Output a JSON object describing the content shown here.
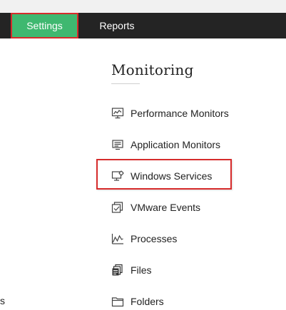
{
  "nav": {
    "tabs": [
      {
        "label": "Settings"
      },
      {
        "label": "Reports"
      }
    ]
  },
  "section": {
    "title": "Monitoring"
  },
  "menu": {
    "items": [
      {
        "label": "Performance Monitors",
        "icon": "performance-monitor-icon"
      },
      {
        "label": "Application Monitors",
        "icon": "application-monitor-icon"
      },
      {
        "label": "Windows Services",
        "icon": "windows-services-icon"
      },
      {
        "label": "VMware Events",
        "icon": "vmware-events-icon"
      },
      {
        "label": "Processes",
        "icon": "processes-icon"
      },
      {
        "label": "Files",
        "icon": "files-icon"
      },
      {
        "label": "Folders",
        "icon": "folders-icon"
      }
    ]
  },
  "left_fragment": "s",
  "colors": {
    "navbar": "#242424",
    "active_tab": "#3fb870",
    "highlight": "#d62b2b"
  }
}
